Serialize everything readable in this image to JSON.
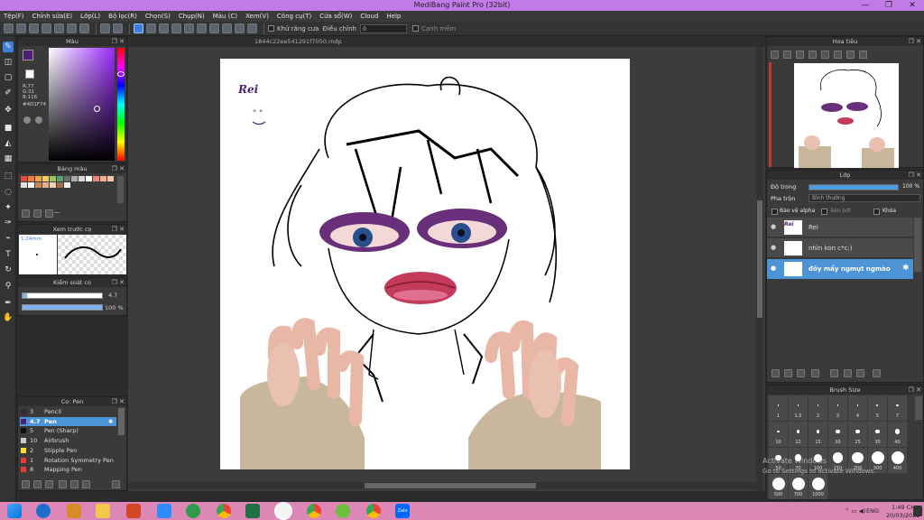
{
  "window": {
    "title": "MediBang Paint Pro (32bit)",
    "controls": [
      "—",
      "❐",
      "✕"
    ]
  },
  "menu": [
    "Tệp(F)",
    "Chỉnh sửa(E)",
    "Lớp(L)",
    "Bộ lọc(R)",
    "Chọn(S)",
    "Chụp(N)",
    "Màu (C)",
    "Xem(V)",
    "Công cụ(T)",
    "Cửa sổ(W)",
    "Cloud",
    "Help"
  ],
  "toolbar": {
    "antialias_label": "Khử răng cưa",
    "adjust_label": "Điều chỉnh",
    "adjust_value": "0",
    "snap_label": "Cạnh mềm"
  },
  "document": {
    "tab": "1844c22ee541291f7050.mdp"
  },
  "color_panel": {
    "title": "Màu",
    "r": "R:77",
    "g": "G:31",
    "b": "B:116",
    "hex": "#4D1F74",
    "primary": "#4d1f74",
    "secondary": "#ffffff"
  },
  "palette_panel": {
    "title": "Bảng màu",
    "more": "---",
    "colors": [
      "#e84a3c",
      "#f07c3a",
      "#f0a640",
      "#f4cf5a",
      "#9fc65a",
      "#5aa06a",
      "#6c6c6c",
      "#aaaaaa",
      "#d9d9d9",
      "#ffffff",
      "#e88a7a",
      "#f2b090",
      "#f2c6a0",
      "#e0e0e0",
      "#ffffff",
      "#c88860",
      "#e0b090",
      "#f0d0b0",
      "#9a7050",
      "#f0f0f0"
    ]
  },
  "brush_preview_panel": {
    "title": "Xem trước cọ",
    "size_label": "1.24mm"
  },
  "brush_control_panel": {
    "title": "Kiểm soát cọ",
    "size_value": "4.7",
    "size_fraction": 0.06,
    "opacity_value": "100 %",
    "opacity_fraction": 1.0
  },
  "brush_list_panel": {
    "title": "Cọ: Pen",
    "items": [
      {
        "size": "3",
        "name": "Pencil",
        "color": "#2d2d2d"
      },
      {
        "size": "4.7",
        "name": "Pen",
        "color": "#4d1f74"
      },
      {
        "size": "5",
        "name": "Pen (Sharp)",
        "color": "#111111"
      },
      {
        "size": "10",
        "name": "Airbrush",
        "color": "#cccccc"
      },
      {
        "size": "2",
        "name": "Stipple Pen",
        "color": "#ffdd33"
      },
      {
        "size": "1",
        "name": "Rotation Symmetry Pen",
        "color": "#e43a3a"
      },
      {
        "size": "8",
        "name": "Mapping Pen",
        "color": "#e43a3a"
      }
    ]
  },
  "navigator_panel": {
    "title": "Hoa tiêu"
  },
  "layer_panel": {
    "title": "Lớp",
    "opacity_label": "Độ trong",
    "opacity_value": "100 %",
    "opacity_fraction": 1.0,
    "blend_label": "Pha trộn",
    "blend_value": "Bình thường",
    "protect_alpha": "Bảo vệ alpha",
    "clip": "Xén bớt",
    "lock": "Khóa",
    "layers": [
      {
        "name": "Rei"
      },
      {
        "name": "nhìn kon c*c:)"
      },
      {
        "name": "đôy mẩy ngmụt ngmào"
      }
    ]
  },
  "brush_size_panel": {
    "title": "Brush Size",
    "rows": [
      [
        "1",
        "1.5",
        "2",
        "3",
        "4",
        "5",
        "7"
      ],
      [
        "10",
        "12",
        "15",
        "20",
        "25",
        "30",
        "40"
      ],
      [
        "50",
        "70",
        "100",
        "150",
        "200",
        "300",
        "400"
      ],
      [
        "500",
        "700",
        "1000"
      ]
    ]
  },
  "canvas": {
    "text_rei": "Rei",
    "text_face": "\" \""
  },
  "watermark": {
    "line1": "Activate Windows",
    "line2": "Go to Settings to activate Windows."
  },
  "taskbar": {
    "lang": "ENG",
    "time": "1:49 CH",
    "date": "20/03/2022"
  }
}
